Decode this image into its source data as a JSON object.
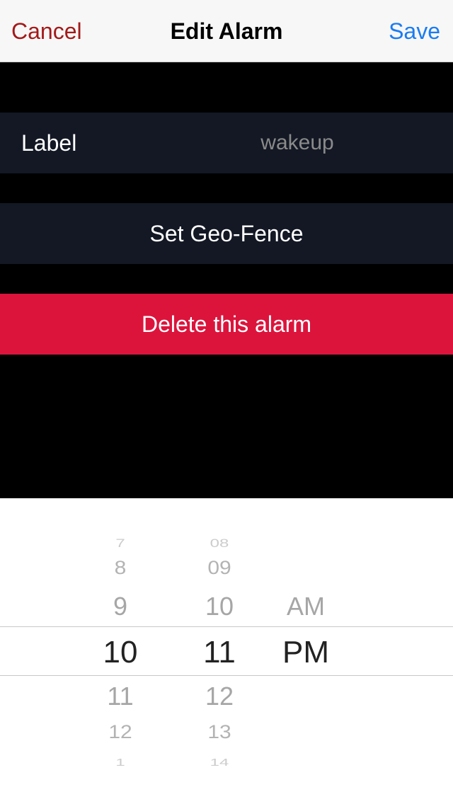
{
  "navbar": {
    "cancel_label": "Cancel",
    "title": "Edit Alarm",
    "save_label": "Save"
  },
  "label_row": {
    "title": "Label",
    "value": "wakeup"
  },
  "geo_fence": {
    "label": "Set Geo-Fence"
  },
  "delete": {
    "label": "Delete this alarm"
  },
  "picker": {
    "hours": {
      "above": [
        "7",
        "8",
        "9"
      ],
      "selected": "10",
      "below": [
        "11",
        "12",
        "1"
      ]
    },
    "minutes": {
      "above": [
        "08",
        "09",
        "10"
      ],
      "selected": "11",
      "below": [
        "12",
        "13",
        "14"
      ]
    },
    "ampm": {
      "above": [
        "AM"
      ],
      "selected": "PM"
    }
  },
  "colors": {
    "cancel": "#a31a1a",
    "save": "#1a7cf2",
    "row_bg": "#131824",
    "delete_bg": "#dc143c"
  }
}
